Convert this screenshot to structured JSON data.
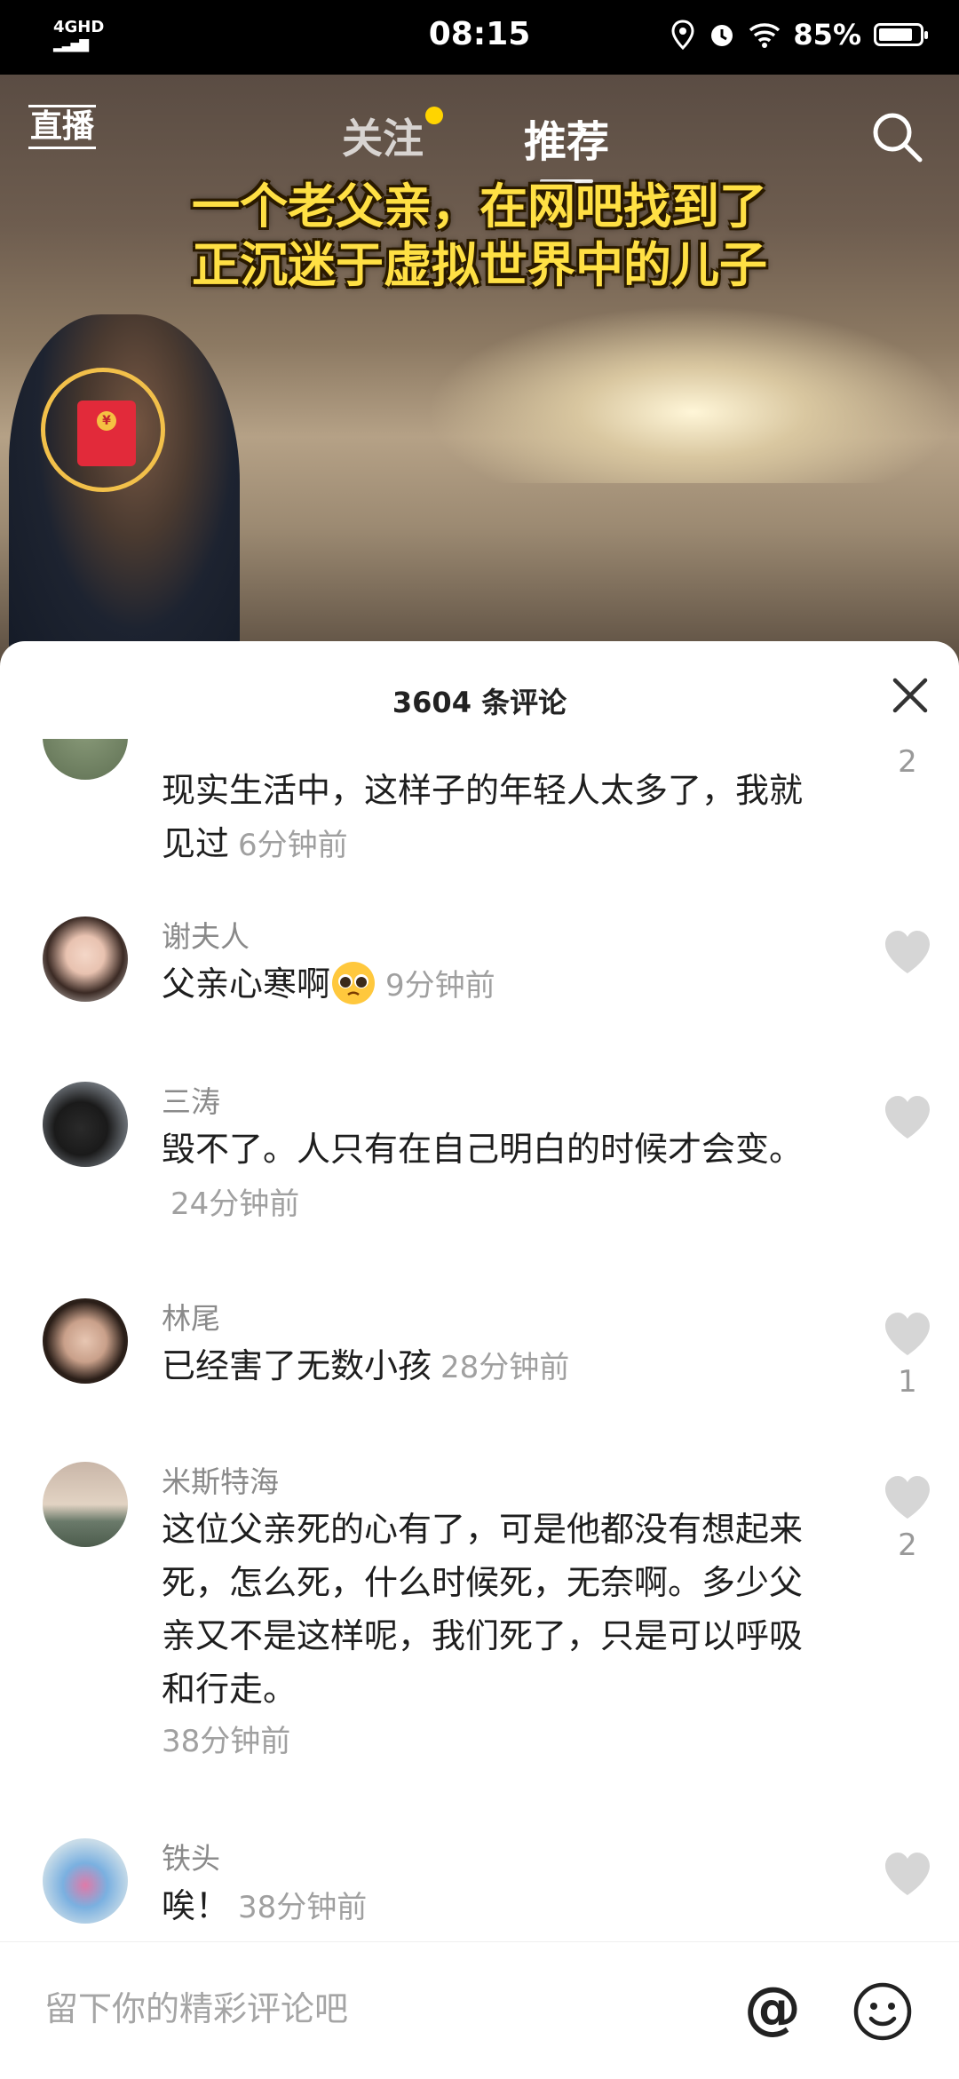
{
  "status_bar": {
    "network": "4GHD",
    "time": "08:15",
    "battery": "85%",
    "battery_level": 0.85
  },
  "top_nav": {
    "live_label": "直播",
    "tabs": [
      {
        "label": "关注",
        "has_dot": true
      },
      {
        "label": "推荐",
        "active": true
      }
    ]
  },
  "video": {
    "caption_line1": "一个老父亲，在网吧找到了",
    "caption_line2": "正沉迷于虚拟世界中的儿子"
  },
  "comments_panel": {
    "title": "3604 条评论",
    "comments": [
      {
        "name": "",
        "text": "现实生活中，这样子的年轻人太多了，我就见过",
        "time": "6分钟前",
        "likes": "2"
      },
      {
        "name": "谢夫人",
        "text": "父亲心寒啊",
        "emoji": "pleading-face-emoji",
        "time": "9分钟前",
        "likes": ""
      },
      {
        "name": "三涛",
        "text": "毁不了。人只有在自己明白的时候才会变。",
        "time": "24分钟前",
        "likes": ""
      },
      {
        "name": "林尾",
        "text": "已经害了无数小孩",
        "time": "28分钟前",
        "likes": "1"
      },
      {
        "name": "米斯特海",
        "text": "这位父亲死的心有了，可是他都没有想起来死，怎么死，什么时候死，无奈啊。多少父亲又不是这样呢，我们死了，只是可以呼吸和行走。",
        "time": "38分钟前",
        "likes": "2"
      },
      {
        "name": "铁头",
        "text": "唉！",
        "time": "38分钟前",
        "likes": ""
      }
    ]
  },
  "input_bar": {
    "placeholder": "留下你的精彩评论吧",
    "at_symbol": "@"
  },
  "colors": {
    "caption": "#ffe044",
    "follow_dot": "#ffd400",
    "red_packet": "#e22a3a"
  }
}
